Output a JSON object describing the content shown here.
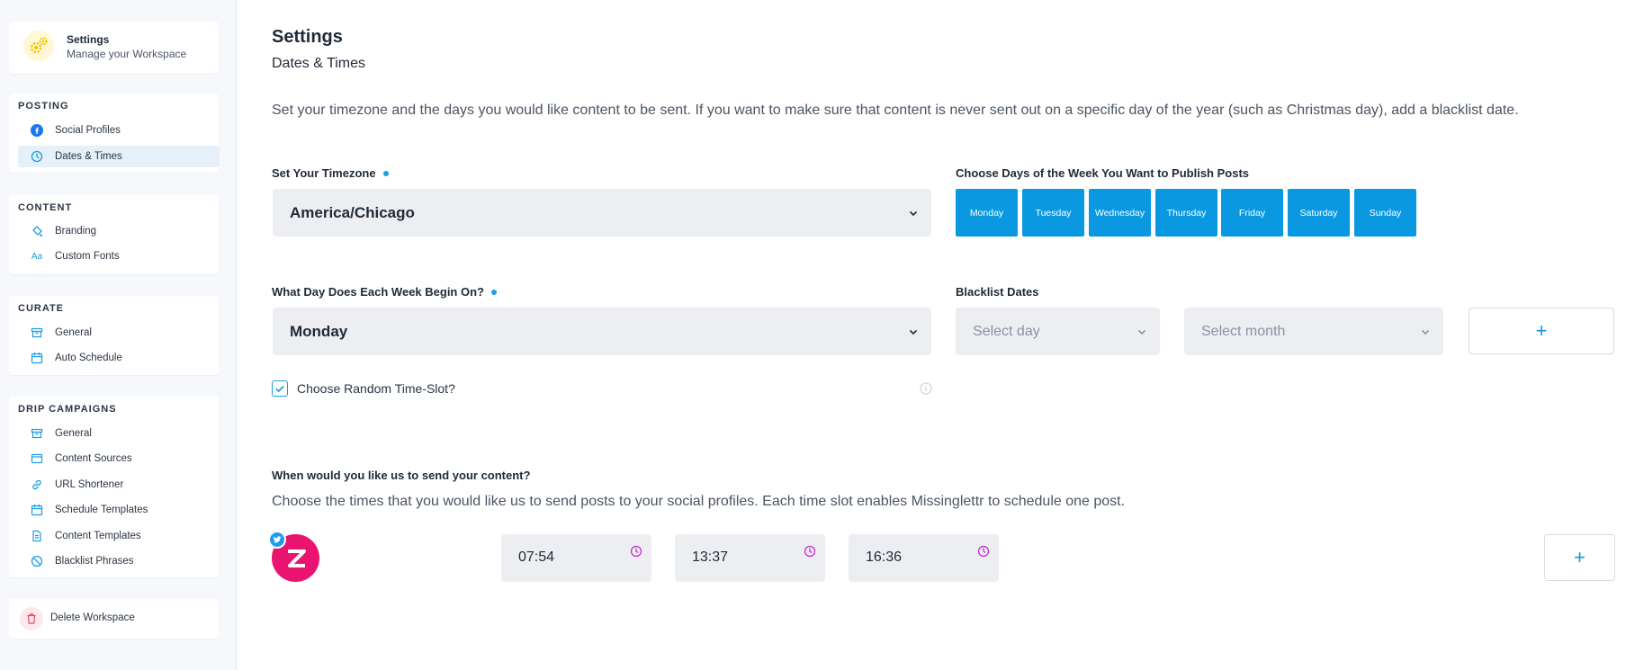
{
  "workspace": {
    "title": "Settings",
    "subtitle": "Manage your Workspace"
  },
  "sidebar": {
    "sections": [
      {
        "title": "POSTING",
        "items": [
          {
            "label": "Social Profiles",
            "icon": "facebook-icon"
          },
          {
            "label": "Dates & Times",
            "icon": "clock-icon",
            "active": true
          }
        ]
      },
      {
        "title": "CONTENT",
        "items": [
          {
            "label": "Branding",
            "icon": "paint-bucket-icon"
          },
          {
            "label": "Custom Fonts",
            "icon": "font-icon"
          }
        ]
      },
      {
        "title": "CURATE",
        "items": [
          {
            "label": "General",
            "icon": "box-icon"
          },
          {
            "label": "Auto Schedule",
            "icon": "calendar-icon"
          }
        ]
      },
      {
        "title": "DRIP CAMPAIGNS",
        "items": [
          {
            "label": "General",
            "icon": "box-icon"
          },
          {
            "label": "Content Sources",
            "icon": "window-icon"
          },
          {
            "label": "URL Shortener",
            "icon": "link-icon"
          },
          {
            "label": "Schedule Templates",
            "icon": "calendar-icon"
          },
          {
            "label": "Content Templates",
            "icon": "document-icon"
          },
          {
            "label": "Blacklist Phrases",
            "icon": "ban-icon"
          }
        ]
      }
    ],
    "delete_label": "Delete Workspace"
  },
  "page": {
    "title": "Settings",
    "subtitle": "Dates & Times",
    "description": "Set your timezone and the days you would like content to be sent. If you want to make sure that content is never sent out on a specific day of the year (such as Christmas day), add a blacklist date."
  },
  "timezone": {
    "label": "Set Your Timezone",
    "value": "America/Chicago"
  },
  "days": {
    "label": "Choose Days of the Week You Want to Publish Posts",
    "items": [
      "Monday",
      "Tuesday",
      "Wednesday",
      "Thursday",
      "Friday",
      "Saturday",
      "Sunday"
    ]
  },
  "week_start": {
    "label": "What Day Does Each Week Begin On?",
    "value": "Monday"
  },
  "blacklist": {
    "label": "Blacklist Dates",
    "day_placeholder": "Select day",
    "month_placeholder": "Select month",
    "add_label": "+"
  },
  "random_slot": {
    "label": "Choose Random Time-Slot?",
    "checked": true
  },
  "schedule": {
    "question": "When would you like us to send your content?",
    "description": "Choose the times that you would like us to send posts to your social profiles. Each time slot enables Missinglettr to schedule one post.",
    "times": [
      "07:54",
      "13:37",
      "16:36"
    ],
    "add_label": "+"
  },
  "colors": {
    "accent": "#0a99e1",
    "avatar": "#e8146f",
    "twitter": "#1d9bf0",
    "clock": "#c026d3"
  }
}
